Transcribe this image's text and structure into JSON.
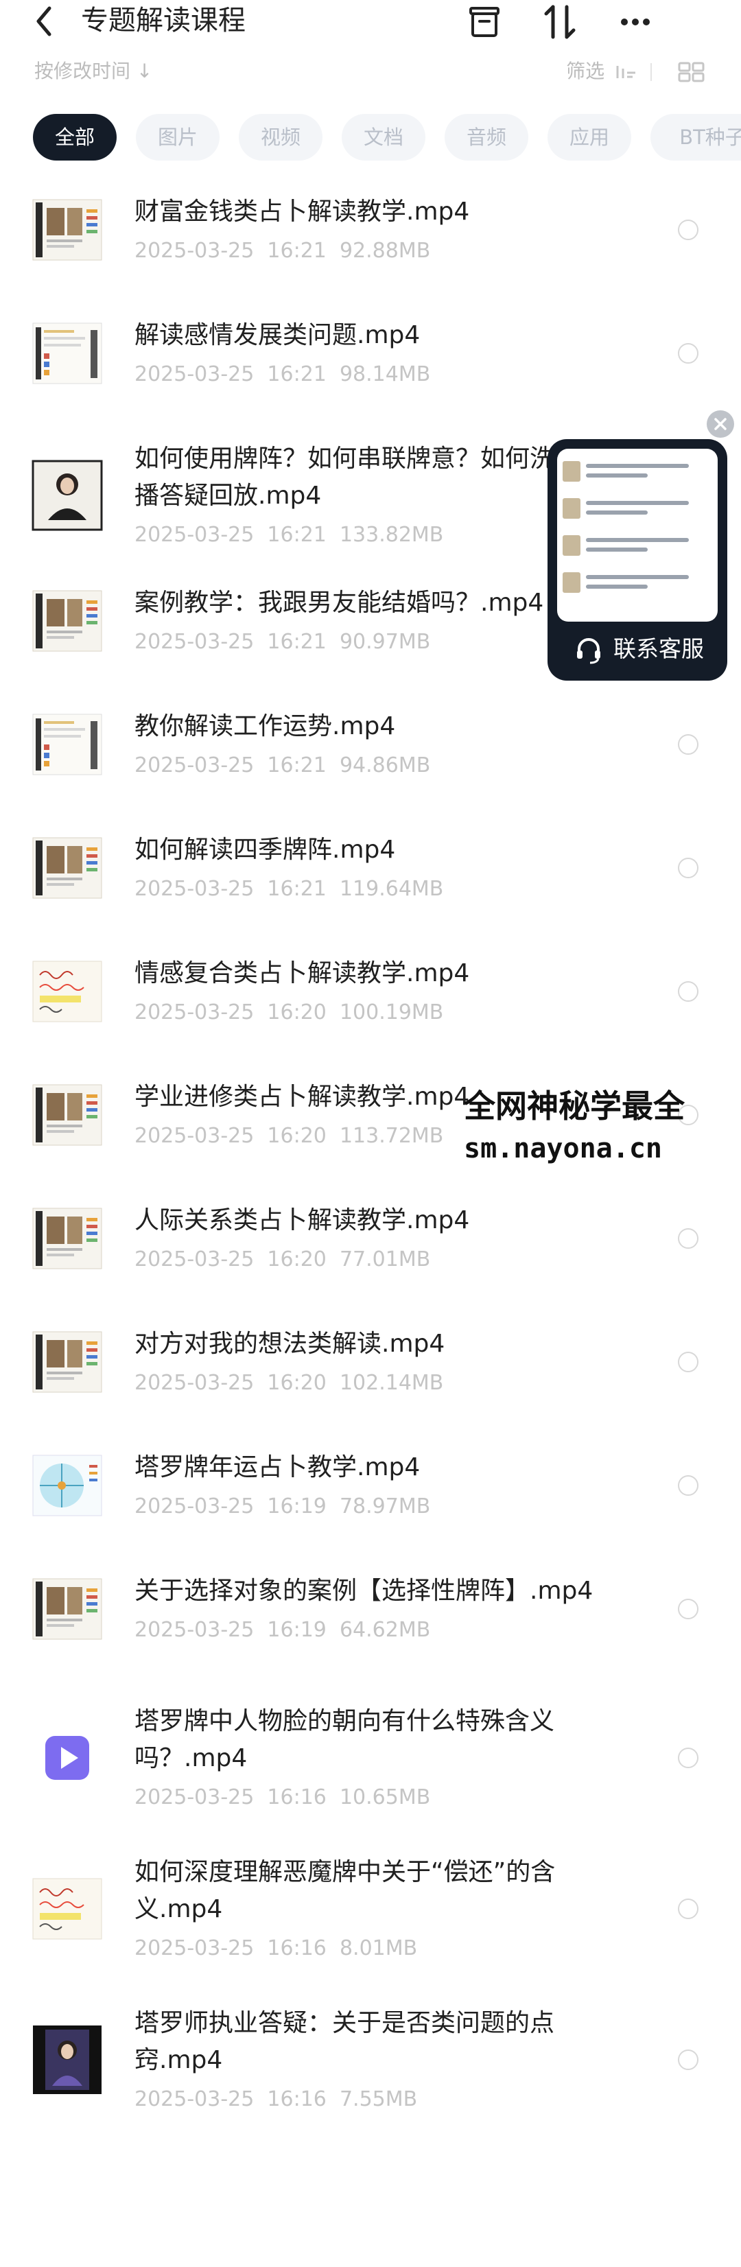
{
  "header": {
    "title": "专题解读课程"
  },
  "toolbar": {
    "sort_label": "按修改时间 ↓",
    "filter_label": "筛选"
  },
  "categories": [
    {
      "label": "全部",
      "active": true
    },
    {
      "label": "图片",
      "active": false
    },
    {
      "label": "视频",
      "active": false
    },
    {
      "label": "文档",
      "active": false
    },
    {
      "label": "音频",
      "active": false
    },
    {
      "label": "应用",
      "active": false
    },
    {
      "label": "BT种子",
      "active": false
    }
  ],
  "files": [
    {
      "name": "财富金钱类占卜解读教学.mp4",
      "date": "2025-03-25  16:21",
      "size": "92.88MB",
      "thumb": "photo-layout"
    },
    {
      "name": "解读感情发展类问题.mp4",
      "date": "2025-03-25  16:21",
      "size": "98.14MB",
      "thumb": "doc-layout"
    },
    {
      "name": "如何使用牌阵？如何串联牌意？如何洗牌？直播答疑回放.mp4",
      "date": "2025-03-25  16:21",
      "size": "133.82MB",
      "thumb": "portrait"
    },
    {
      "name": "案例教学：我跟男友能结婚吗？.mp4",
      "date": "2025-03-25  16:21",
      "size": "90.97MB",
      "thumb": "photo-layout"
    },
    {
      "name": "教你解读工作运势.mp4",
      "date": "2025-03-25  16:21",
      "size": "94.86MB",
      "thumb": "doc-layout"
    },
    {
      "name": "如何解读四季牌阵.mp4",
      "date": "2025-03-25  16:21",
      "size": "119.64MB",
      "thumb": "photo-layout"
    },
    {
      "name": "情感复合类占卜解读教学.mp4",
      "date": "2025-03-25  16:20",
      "size": "100.19MB",
      "thumb": "handwriting"
    },
    {
      "name": "学业进修类占卜解读教学.mp4",
      "date": "2025-03-25  16:20",
      "size": "113.72MB",
      "thumb": "photo-layout"
    },
    {
      "name": "人际关系类占卜解读教学.mp4",
      "date": "2025-03-25  16:20",
      "size": "77.01MB",
      "thumb": "photo-layout"
    },
    {
      "name": "对方对我的想法类解读.mp4",
      "date": "2025-03-25  16:20",
      "size": "102.14MB",
      "thumb": "photo-layout"
    },
    {
      "name": "塔罗牌年运占卜教学.mp4",
      "date": "2025-03-25  16:19",
      "size": "78.97MB",
      "thumb": "diagram"
    },
    {
      "name": "关于选择对象的案例【选择性牌阵】.mp4",
      "date": "2025-03-25  16:19",
      "size": "64.62MB",
      "thumb": "photo-layout"
    },
    {
      "name": "塔罗牌中人物脸的朝向有什么特殊含义吗？.mp4",
      "date": "2025-03-25  16:16",
      "size": "10.65MB",
      "thumb": "video-icon"
    },
    {
      "name": "如何深度理解恶魔牌中关于“偿还”的含义.mp4",
      "date": "2025-03-25  16:16",
      "size": "8.01MB",
      "thumb": "handwriting"
    },
    {
      "name": "塔罗师执业答疑：关于是否类问题的点窍.mp4",
      "date": "2025-03-25  16:16",
      "size": "7.55MB",
      "thumb": "portrait-dark"
    }
  ],
  "float_widget": {
    "label": "联系客服"
  },
  "watermark": {
    "line1": "全网神秘学最全",
    "line2": "sm.nayona.cn"
  }
}
